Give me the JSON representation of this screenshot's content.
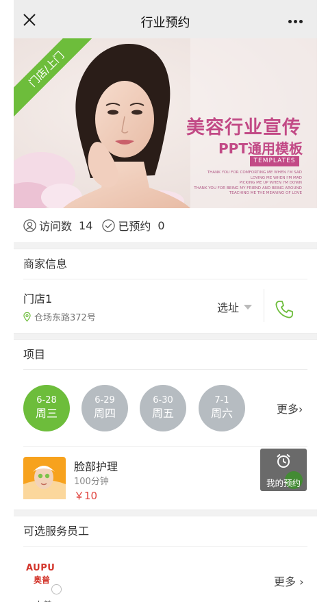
{
  "navbar": {
    "title": "行业预约"
  },
  "banner": {
    "ribbon": "门店/上门",
    "title": "美容行业宣传",
    "subtitle": "PPT通用模板",
    "tag": "TEMPLATES",
    "lines": [
      "THANK YOU FOR COMFORTING ME WHEN I'M SAD",
      "LOVING ME WHEN I'M MAD",
      "PICKING ME UP WHEN I'M DOWN",
      "THANK YOU FOR BEING MY FRIEND AND BEING AROUND",
      "TEACHING ME THE MEANING OF LOVE"
    ]
  },
  "stats": {
    "visits_label": "访问数",
    "visits_count": "14",
    "booked_label": "已预约",
    "booked_count": "0"
  },
  "merchant": {
    "header": "商家信息",
    "store_name": "门店1",
    "address": "仓场东路372号",
    "select_label": "选址"
  },
  "project": {
    "header": "项目",
    "dates": [
      {
        "date": "6-28",
        "weekday": "周三",
        "active": true
      },
      {
        "date": "6-29",
        "weekday": "周四",
        "active": false
      },
      {
        "date": "6-30",
        "weekday": "周五",
        "active": false
      },
      {
        "date": "7-1",
        "weekday": "周六",
        "active": false
      }
    ],
    "more_label": "更多",
    "service": {
      "name": "脸部护理",
      "duration": "100分钟",
      "price": "￥10"
    },
    "my_booking_label": "我的预约"
  },
  "staff": {
    "header": "可选服务员工",
    "logo_en": "AUPU",
    "logo_cn": "奥普",
    "name": "小美",
    "more_label": "更多"
  },
  "colors": {
    "accent": "#6dbd3b",
    "price": "#e0443f",
    "brand": "#c24a86",
    "inactive_date": "#b6bcc1"
  }
}
